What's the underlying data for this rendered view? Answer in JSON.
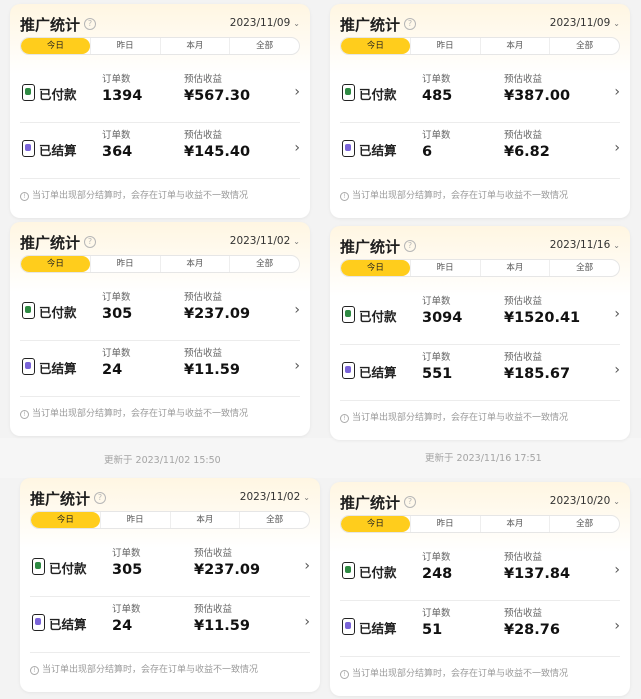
{
  "cards": [
    {
      "title": "推广统计",
      "date": "2023/11/09",
      "tabs": [
        "今日",
        "昨日",
        "本月",
        "全部"
      ],
      "paid": {
        "label": "已付款",
        "orders_label": "订单数",
        "orders": "1394",
        "income_label": "预估收益",
        "income": "¥567.30"
      },
      "settled": {
        "label": "已结算",
        "orders_label": "订单数",
        "orders": "364",
        "income_label": "预估收益",
        "income": "¥145.40"
      },
      "note": "当订单出现部分结算时，会存在订单与收益不一致情况"
    },
    {
      "title": "推广统计",
      "date": "2023/11/09",
      "tabs": [
        "今日",
        "昨日",
        "本月",
        "全部"
      ],
      "paid": {
        "label": "已付款",
        "orders_label": "订单数",
        "orders": "485",
        "income_label": "预估收益",
        "income": "¥387.00"
      },
      "settled": {
        "label": "已结算",
        "orders_label": "订单数",
        "orders": "6",
        "income_label": "预估收益",
        "income": "¥6.82"
      },
      "note": "当订单出现部分结算时，会存在订单与收益不一致情况"
    },
    {
      "title": "推广统计",
      "date": "2023/11/02",
      "tabs": [
        "今日",
        "昨日",
        "本月",
        "全部"
      ],
      "paid": {
        "label": "已付款",
        "orders_label": "订单数",
        "orders": "305",
        "income_label": "预估收益",
        "income": "¥237.09"
      },
      "settled": {
        "label": "已结算",
        "orders_label": "订单数",
        "orders": "24",
        "income_label": "预估收益",
        "income": "¥11.59"
      },
      "note": "当订单出现部分结算时，会存在订单与收益不一致情况"
    },
    {
      "title": "推广统计",
      "date": "2023/11/16",
      "tabs": [
        "今日",
        "昨日",
        "本月",
        "全部"
      ],
      "paid": {
        "label": "已付款",
        "orders_label": "订单数",
        "orders": "3094",
        "income_label": "预估收益",
        "income": "¥1520.41"
      },
      "settled": {
        "label": "已结算",
        "orders_label": "订单数",
        "orders": "551",
        "income_label": "预估收益",
        "income": "¥185.67"
      },
      "note": "当订单出现部分结算时，会存在订单与收益不一致情况"
    },
    {
      "title": "推广统计",
      "date": "2023/11/02",
      "tabs": [
        "今日",
        "昨日",
        "本月",
        "全部"
      ],
      "paid": {
        "label": "已付款",
        "orders_label": "订单数",
        "orders": "305",
        "income_label": "预估收益",
        "income": "¥237.09"
      },
      "settled": {
        "label": "已结算",
        "orders_label": "订单数",
        "orders": "24",
        "income_label": "预估收益",
        "income": "¥11.59"
      },
      "note": "当订单出现部分结算时，会存在订单与收益不一致情况"
    },
    {
      "title": "推广统计",
      "date": "2023/10/20",
      "tabs": [
        "今日",
        "昨日",
        "本月",
        "全部"
      ],
      "paid": {
        "label": "已付款",
        "orders_label": "订单数",
        "orders": "248",
        "income_label": "预估收益",
        "income": "¥137.84"
      },
      "settled": {
        "label": "已结算",
        "orders_label": "订单数",
        "orders": "51",
        "income_label": "预估收益",
        "income": "¥28.76"
      },
      "note": "当订单出现部分结算时，会存在订单与收益不一致情况"
    }
  ],
  "updated": [
    "更新于 2023/11/02 15:50",
    "更新于 2023/11/16 17:51"
  ],
  "colors": {
    "accent": "#ffcd1c",
    "paid_icon": "#2f8a43",
    "settled_icon": "#7a64d8"
  },
  "icons": {
    "help": "question-circle-icon",
    "paid": "wallet-icon",
    "settled": "receipt-icon",
    "row_arrow": "chevron-right-icon",
    "date_dropdown": "chevron-down-icon",
    "note": "info-circle-icon"
  }
}
